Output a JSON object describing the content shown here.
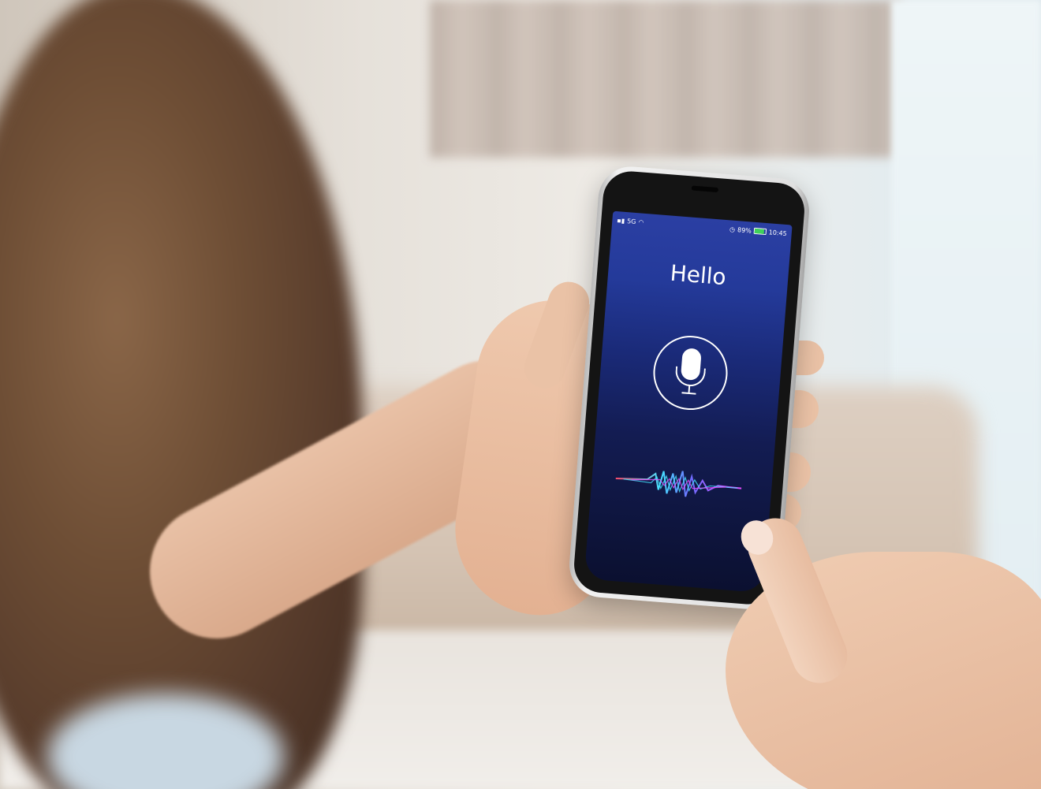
{
  "scene": {
    "description_tags": [
      "woman",
      "smartphone",
      "voice-assistant"
    ]
  },
  "phone": {
    "status_bar": {
      "signal_label": "5G",
      "battery_percent": "89%",
      "battery_level": 0.89,
      "time": "10:45"
    },
    "screen": {
      "greeting": "Hello",
      "mic_icon": "microphone-icon",
      "waveform_icon": "sound-waveform"
    },
    "colors": {
      "screen_top": "#2b3fa3",
      "screen_bottom": "#0b1030",
      "wave_cyan": "#45e3ff",
      "wave_magenta": "#e94cff",
      "wave_red": "#ff4a6a",
      "battery_green": "#3fd25a"
    }
  }
}
